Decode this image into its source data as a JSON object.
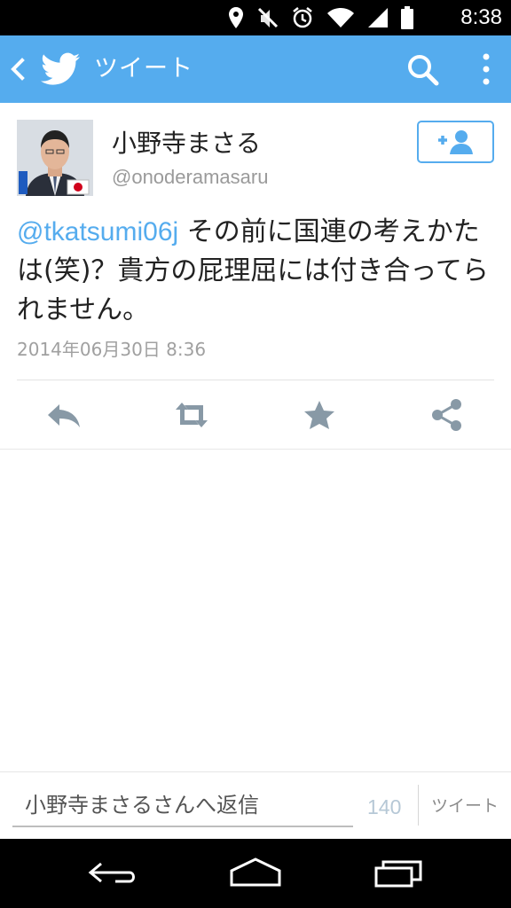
{
  "status_bar": {
    "time": "8:38",
    "icons": [
      "location-icon",
      "mute-icon",
      "alarm-icon",
      "wifi-icon",
      "signal-icon",
      "battery-icon"
    ]
  },
  "app_bar": {
    "title": "ツイート",
    "background_color": "#55acee",
    "icons": [
      "back-icon",
      "twitter-bird-icon",
      "search-icon",
      "more-vert-icon"
    ]
  },
  "tweet": {
    "user_name": "小野寺まさる",
    "user_handle": "@onoderamasaru",
    "follow_icon": "add-user-icon",
    "mention": "@tkatsumi06j",
    "text": "その前に国連の考えかたは(笑)？貴方の屁理屈には付き合ってられません。",
    "date": "2014年06月30日 8:36",
    "actions": [
      "reply-icon",
      "retweet-icon",
      "favorite-star-icon",
      "share-icon"
    ]
  },
  "reply_bar": {
    "placeholder": "小野寺まさるさんへ返信",
    "char_count": "140",
    "tweet_button": "ツイート"
  },
  "nav_bar": {
    "icons": [
      "back-nav-icon",
      "home-nav-icon",
      "recents-nav-icon"
    ]
  },
  "colors": {
    "accent": "#55acee",
    "text": "#222222",
    "secondary_text": "#9a9a9a"
  }
}
